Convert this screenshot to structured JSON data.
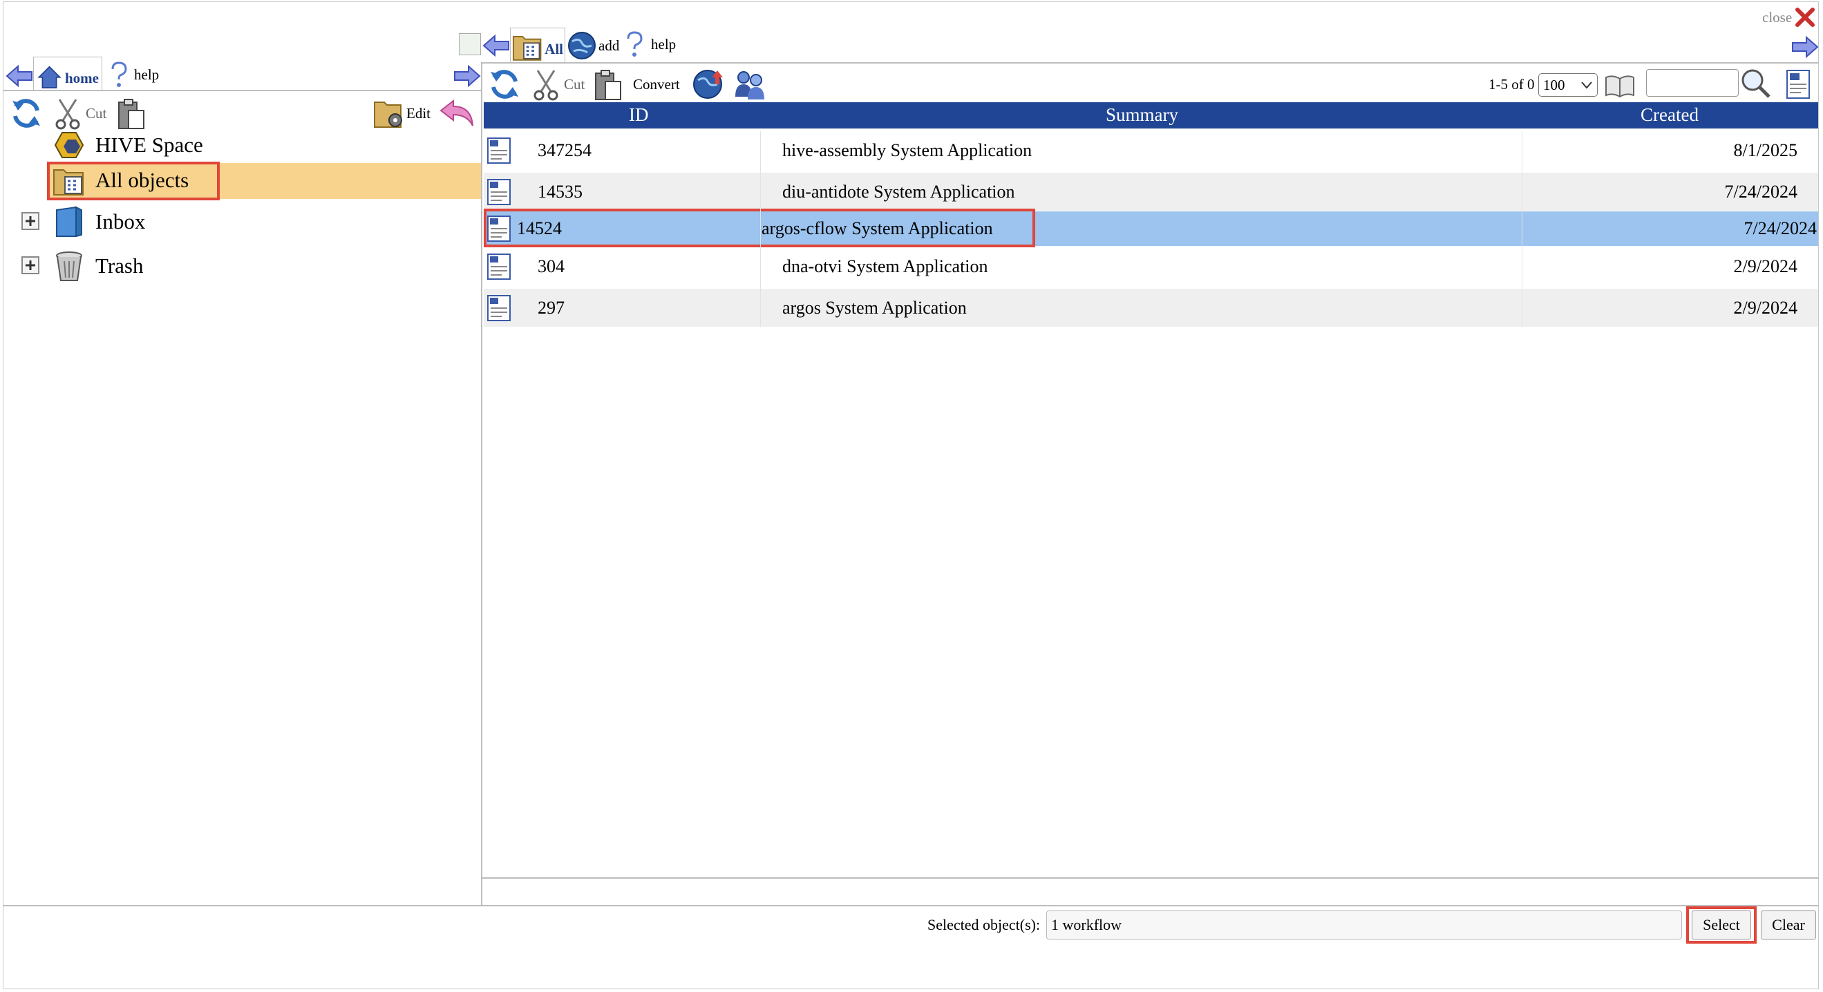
{
  "window": {
    "close_label": "close"
  },
  "left_panel": {
    "tabs": {
      "home_label": "home",
      "help_label": "help"
    },
    "toolbar": {
      "cut_label": "Cut",
      "edit_label": "Edit"
    },
    "tree": [
      {
        "label": "HIVE Space",
        "icon": "hive-space-icon"
      },
      {
        "label": "All objects",
        "icon": "all-objects-folder-icon"
      },
      {
        "label": "Inbox",
        "icon": "inbox-icon"
      },
      {
        "label": "Trash",
        "icon": "trash-icon"
      }
    ]
  },
  "right_panel": {
    "tabs": {
      "all_label": "All",
      "add_label": "add",
      "help_label": "help"
    },
    "toolbar": {
      "cut_label": "Cut",
      "convert_label": "Convert",
      "pager_text": "1-5 of 0",
      "page_size": "100",
      "search_value": ""
    },
    "table": {
      "columns": [
        "ID",
        "Summary",
        "Created"
      ],
      "rows": [
        {
          "id": "347254",
          "summary": "hive-assembly System Application",
          "created": "8/1/2025"
        },
        {
          "id": "14535",
          "summary": "diu-antidote System Application",
          "created": "7/24/2024"
        },
        {
          "id": "14524",
          "summary": "argos-cflow System Application",
          "created": "7/24/2024"
        },
        {
          "id": "304",
          "summary": "dna-otvi System Application",
          "created": "2/9/2024"
        },
        {
          "id": "297",
          "summary": "argos System Application",
          "created": "2/9/2024"
        }
      ]
    }
  },
  "footer": {
    "selected_label": "Selected object(s):",
    "selected_value": "1 workflow",
    "select_button": "Select",
    "clear_button": "Clear"
  },
  "colors": {
    "header_blue": "#1f4594",
    "selected_row": "#9cc4ef",
    "tree_highlight": "#f8d38d",
    "annotation_red": "#e0463a"
  }
}
